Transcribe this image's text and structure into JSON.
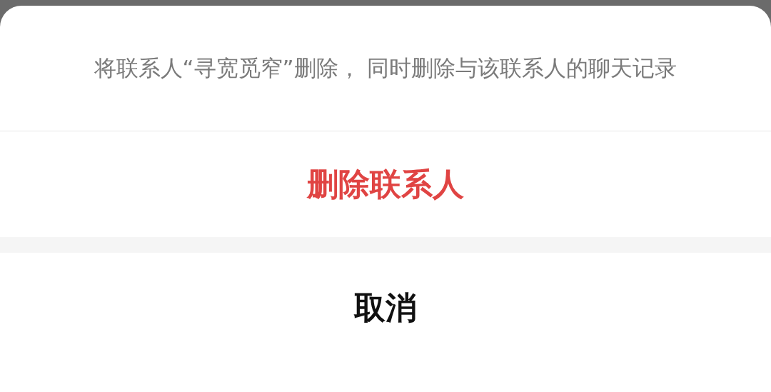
{
  "sheet": {
    "message": "将联系人“寻宽觅窄”删除， 同时删除与该联系人的聊天记录",
    "actions": [
      {
        "label": "删除联系人",
        "kind": "destructive"
      }
    ],
    "cancel": {
      "label": "取消"
    }
  }
}
